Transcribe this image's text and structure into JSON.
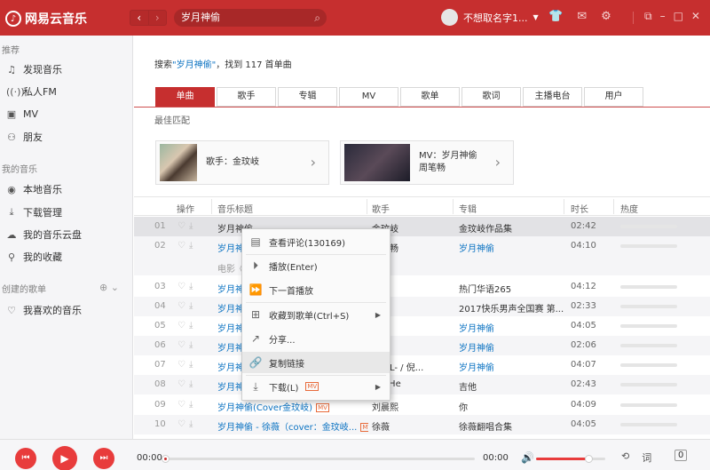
{
  "app": {
    "name": "网易云音乐",
    "search_value": "岁月神偷",
    "username": "不想取名字1...",
    "accent": "#c62f2f"
  },
  "sidebar": {
    "sections": [
      {
        "title": "推荐",
        "items": [
          {
            "label": "发现音乐",
            "icon": "music-note-icon"
          },
          {
            "label": "私人FM",
            "icon": "radio-icon"
          },
          {
            "label": "MV",
            "icon": "video-icon"
          },
          {
            "label": "朋友",
            "icon": "friends-icon"
          }
        ]
      },
      {
        "title": "我的音乐",
        "items": [
          {
            "label": "本地音乐",
            "icon": "disc-icon"
          },
          {
            "label": "下载管理",
            "icon": "download-icon"
          },
          {
            "label": "我的音乐云盘",
            "icon": "cloud-icon"
          },
          {
            "label": "我的收藏",
            "icon": "user-collection-icon"
          }
        ]
      },
      {
        "title": "创建的歌单",
        "items": [
          {
            "label": "我喜欢的音乐",
            "icon": "heart-icon"
          }
        ]
      }
    ]
  },
  "search": {
    "prefix": "搜索",
    "keyword": "\"岁月神偷\"",
    "suffix": "，找到 117 首单曲",
    "tabs": [
      "单曲",
      "歌手",
      "专辑",
      "MV",
      "歌单",
      "歌词",
      "主播电台",
      "用户"
    ],
    "active_tab": 0,
    "best_match_label": "最佳匹配",
    "best_artist": "歌手：金玟岐",
    "best_mv_line1": "MV：岁月神偷",
    "best_mv_line2": "周笔畅"
  },
  "table": {
    "headers": {
      "ops": "操作",
      "title": "音乐标题",
      "artist": "歌手",
      "album": "专辑",
      "duration": "时长",
      "heat": "热度"
    },
    "rows": [
      {
        "num": "01",
        "title": "岁月神偷",
        "artist": "金玟岐",
        "album": "金玟岐作品集",
        "duration": "02:42",
        "heat": 0.95
      },
      {
        "num": "02",
        "title": "岁月神偷",
        "artist": "周笔畅",
        "album": "岁月神偷",
        "duration": "04:10",
        "heat": 0.9
      },
      {
        "num": "03",
        "title": "岁月神偷",
        "artist": "",
        "album": "热门华语265",
        "duration": "04:12",
        "heat": 0.88
      },
      {
        "num": "04",
        "title": "岁月神偷",
        "artist": "",
        "album": "2017快乐男声全国赛 第...",
        "duration": "02:33",
        "heat": 0.86
      },
      {
        "num": "05",
        "title": "岁月神偷",
        "artist": "",
        "album": "岁月神偷",
        "duration": "04:05",
        "heat": 0.85
      },
      {
        "num": "06",
        "title": "岁月神偷",
        "artist": "",
        "album": "岁月神偷",
        "duration": "02:06",
        "heat": 0.84
      },
      {
        "num": "07",
        "title": "岁月神偷",
        "artist": "大哥L- / 倪...",
        "album": "岁月神偷",
        "duration": "04:07",
        "heat": 0.82
      },
      {
        "num": "08",
        "title": "岁月神偷",
        "artist": "am He",
        "album": "吉他",
        "duration": "02:43",
        "heat": 0.78
      },
      {
        "num": "09",
        "title": "岁月神偷(Cover金玟岐)",
        "artist": "刘晨熙",
        "album": "你",
        "duration": "04:09",
        "heat": 0.76
      },
      {
        "num": "10",
        "title": "岁月神偷 - 徐薇（cover：金玟岐...",
        "artist": "徐薇",
        "album": "徐薇翻唱合集",
        "duration": "04:05",
        "heat": 0.75
      }
    ],
    "subline": "电影《"
  },
  "context_menu": {
    "items": [
      {
        "label": "查看评论(130169)",
        "icon": "comment-icon"
      },
      {
        "label": "播放(Enter)",
        "icon": "play-circle-icon"
      },
      {
        "label": "下一首播放",
        "icon": "play-next-icon"
      },
      {
        "label": "收藏到歌单(Ctrl+S)",
        "icon": "add-to-playlist-icon"
      },
      {
        "label": "分享...",
        "icon": "share-icon"
      },
      {
        "label": "复制链接",
        "icon": "link-icon"
      },
      {
        "label": "下载(L)",
        "icon": "download-icon"
      }
    ],
    "tag_label": "MV"
  },
  "player": {
    "current_time": "00:00",
    "total_time": "00:00",
    "playlist_count": "0",
    "lyric_label": "词",
    "volume": 0.75
  }
}
